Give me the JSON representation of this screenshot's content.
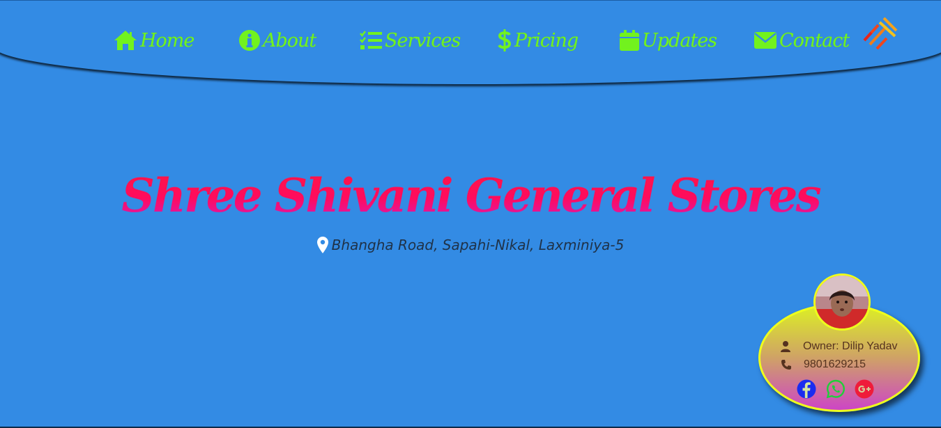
{
  "nav": {
    "items": [
      {
        "label": "Home",
        "icon": "home-icon"
      },
      {
        "label": "About",
        "icon": "info-circle-icon"
      },
      {
        "label": "Services",
        "icon": "tasks-list-icon"
      },
      {
        "label": "Pricing",
        "icon": "dollar-icon"
      },
      {
        "label": "Updates",
        "icon": "calendar-icon"
      },
      {
        "label": "Contact",
        "icon": "envelope-icon"
      }
    ],
    "menu_icon": "hamburger-menu-icon"
  },
  "hero": {
    "title": "Shree Shivani General Stores",
    "address": "Bhangha Road, Sapahi-Nikal, Laxminiya-5"
  },
  "owner": {
    "name_line": "Owner: Dilip Yadav",
    "phone": "9801629215",
    "social": [
      {
        "icon": "facebook-icon",
        "color": "#1a2cf0"
      },
      {
        "icon": "whatsapp-icon",
        "color": "#1fcf3a"
      },
      {
        "icon": "google-plus-icon",
        "color": "#ef1c3a"
      }
    ]
  },
  "colors": {
    "background": "#338be4",
    "nav_text": "#72f21e",
    "title_gradient_start": "#ff1744",
    "title_gradient_end": "#d81ab8",
    "card_border": "#efff1c"
  }
}
